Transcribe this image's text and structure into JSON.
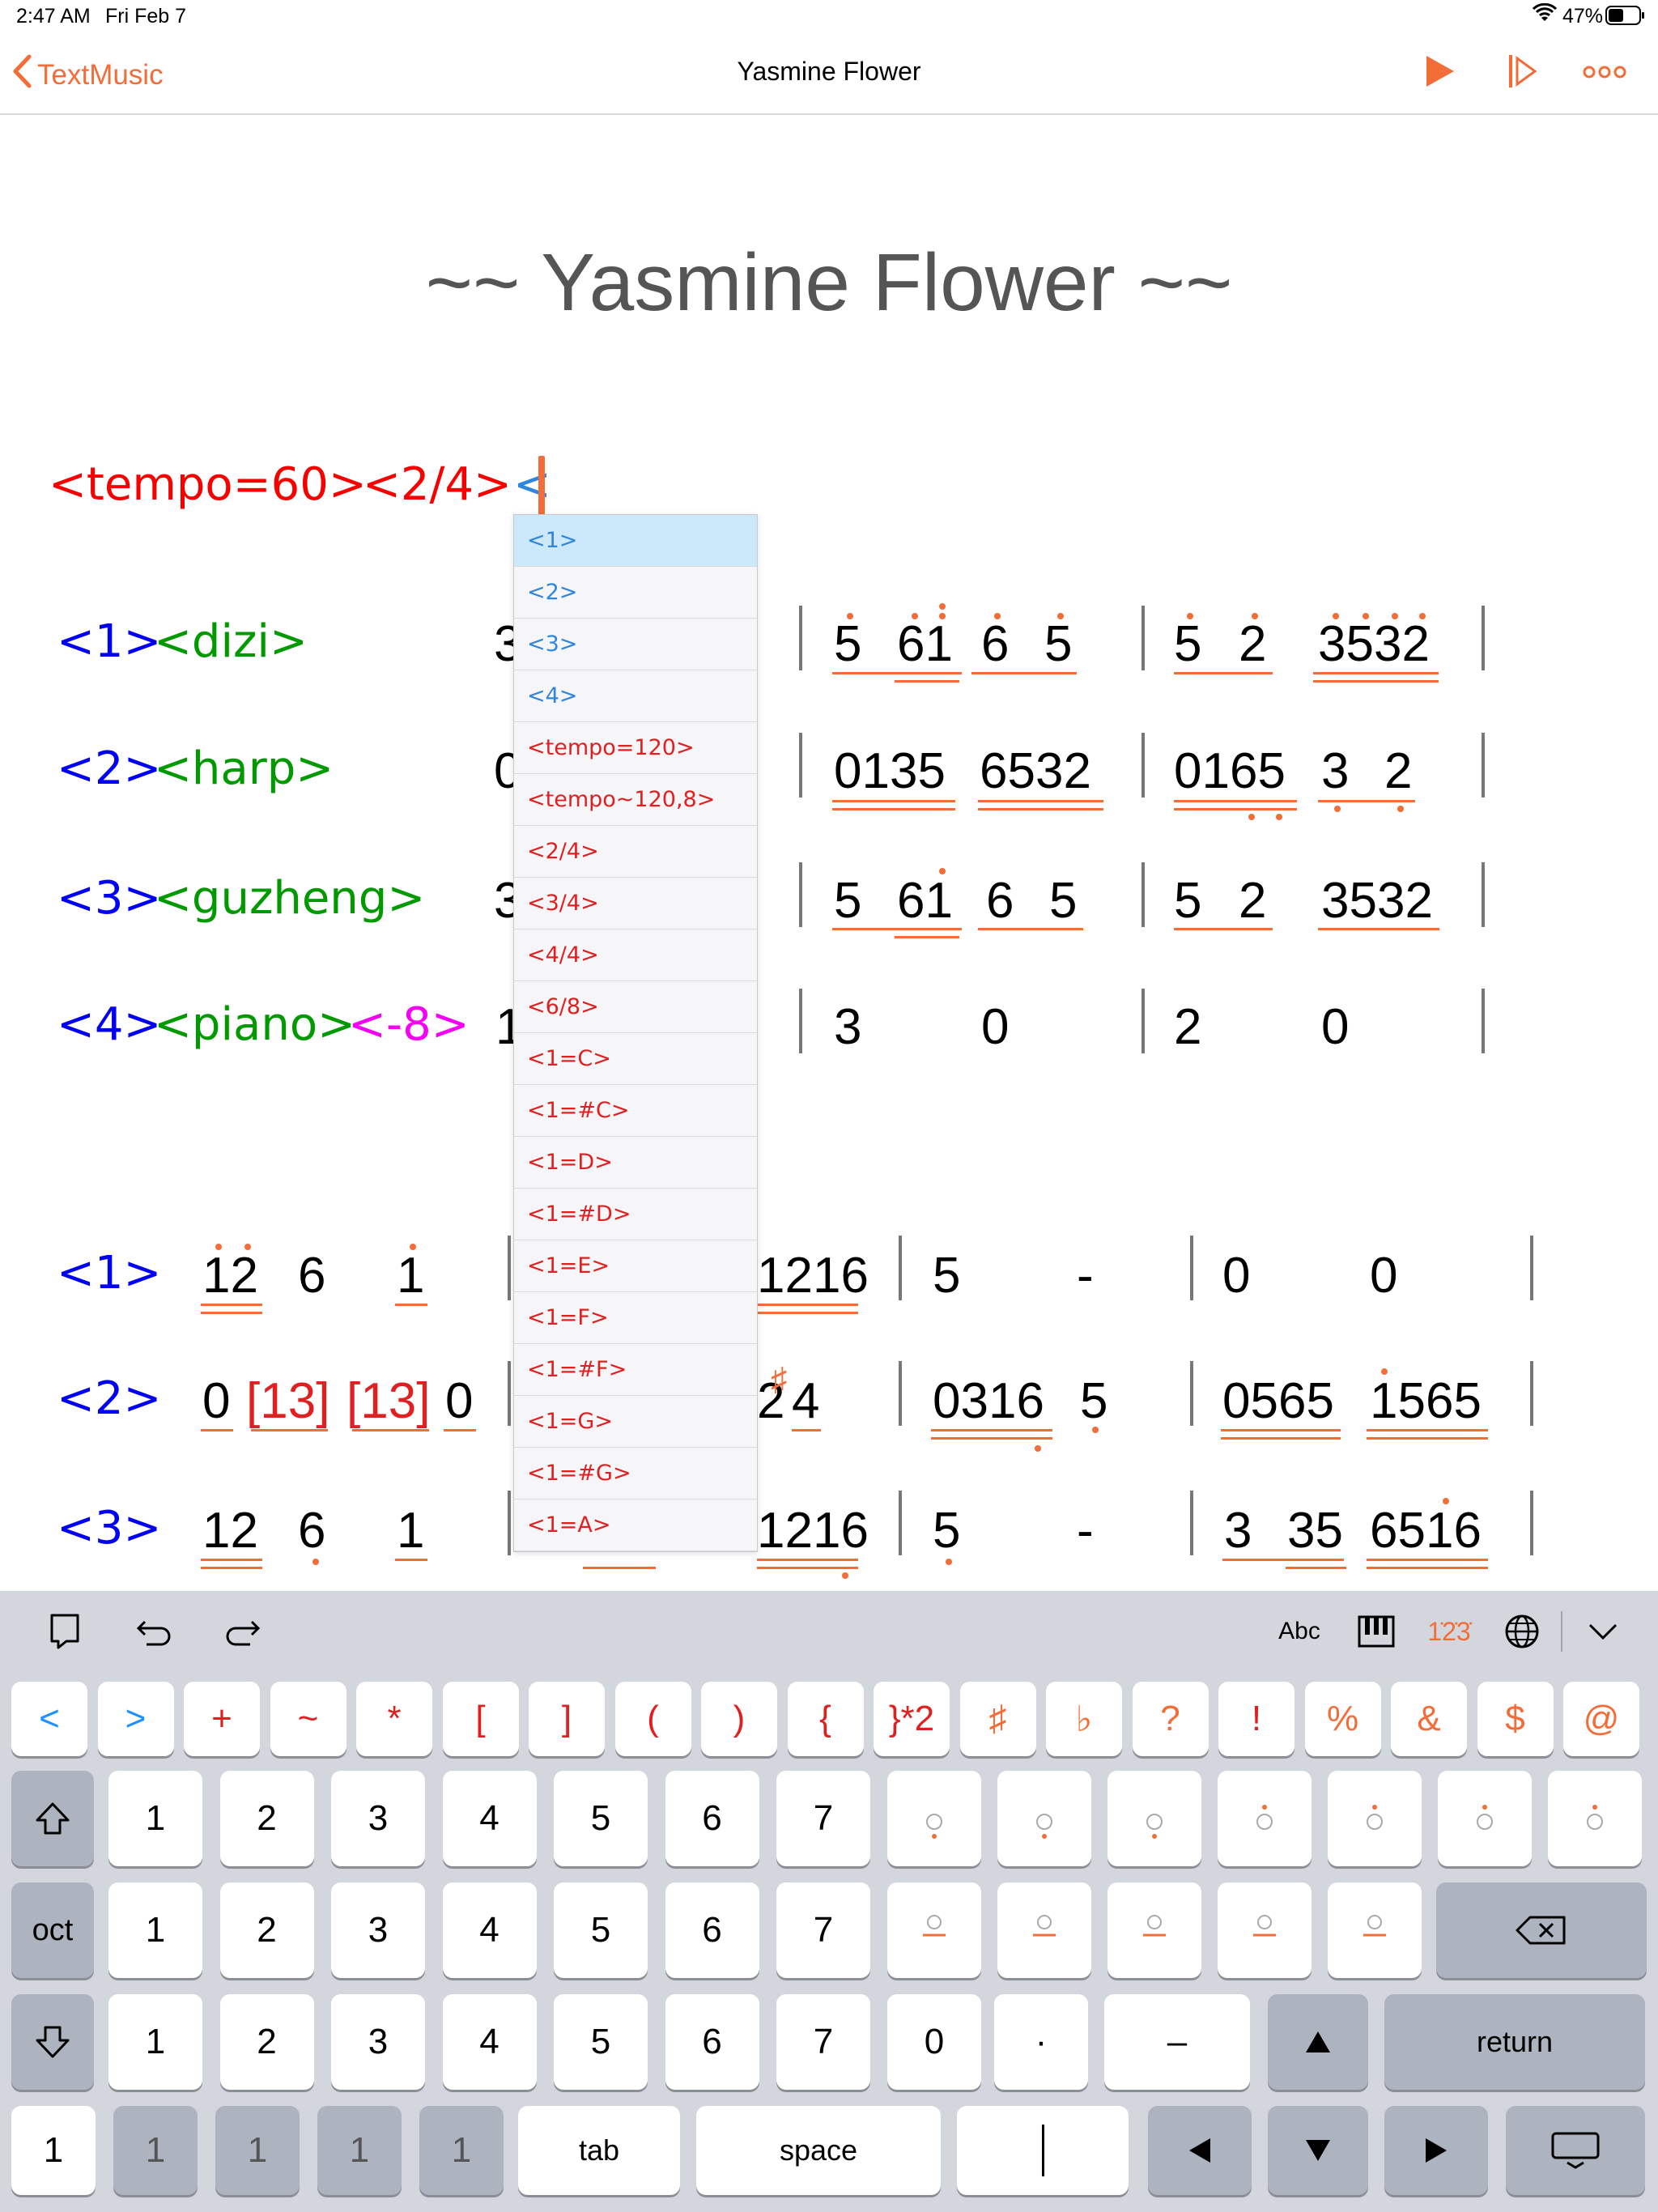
{
  "status_bar": {
    "time": "2:47 AM",
    "date": "Fri Feb 7",
    "battery": "47%"
  },
  "nav": {
    "back_label": "TextMusic",
    "title": "Yasmine Flower",
    "icons": [
      "play-icon",
      "play-step-icon",
      "more-icon"
    ]
  },
  "doc": {
    "title": "~~ Yasmine Flower ~~",
    "header_line": {
      "tempo": "<tempo=60>",
      "time_sig": "<2/4>",
      "typed": "<"
    },
    "system1": {
      "rows": [
        {
          "id": "<1>",
          "instrument": "<dizi>",
          "extra": "",
          "lead": "3",
          "m2": [
            "5",
            "61",
            "6",
            "5"
          ],
          "m3": [
            "5",
            "2",
            "3532"
          ]
        },
        {
          "id": "<2>",
          "instrument": "<harp>",
          "extra": "",
          "lead": "0",
          "m2": [
            "0135",
            "6532"
          ],
          "m3": [
            "0165",
            "3",
            "2"
          ]
        },
        {
          "id": "<3>",
          "instrument": "<guzheng>",
          "extra": "",
          "lead": "3",
          "m2": [
            "5",
            "61",
            "6",
            "5"
          ],
          "m3": [
            "5",
            "2",
            "3532"
          ]
        },
        {
          "id": "<4>",
          "instrument": "<piano>",
          "extra": "<-8>",
          "lead": "1",
          "m2": [
            "3",
            "0"
          ],
          "m3": [
            "2",
            "0"
          ]
        }
      ]
    },
    "system2": {
      "rows": [
        {
          "id": "<1>",
          "m1": [
            "12",
            "6",
            "1"
          ],
          "m2_tail": "1216",
          "m3": [
            "5",
            "-"
          ],
          "m4": [
            "0",
            "0"
          ]
        },
        {
          "id": "<2>",
          "m1": [
            "0",
            "[13]",
            "[13]",
            "0"
          ],
          "m2_tail": "2",
          "m2_sharp": "♯",
          "m2_last": "4",
          "m3": [
            "0316",
            "5"
          ],
          "m4": [
            "0565",
            "1565"
          ]
        },
        {
          "id": "<3>",
          "m1": [
            "12",
            "6",
            "1"
          ],
          "m2_tail": "1216",
          "m3": [
            "5",
            "-"
          ],
          "m4": [
            "3",
            "35",
            "6516"
          ]
        }
      ]
    }
  },
  "autocomplete": {
    "items": [
      {
        "label": "<1>",
        "kind": "blue"
      },
      {
        "label": "<2>",
        "kind": "blue"
      },
      {
        "label": "<3>",
        "kind": "blue"
      },
      {
        "label": "<4>",
        "kind": "blue"
      },
      {
        "label": "<tempo=120>",
        "kind": "red"
      },
      {
        "label": "<tempo~120,8>",
        "kind": "red"
      },
      {
        "label": "<2/4>",
        "kind": "red"
      },
      {
        "label": "<3/4>",
        "kind": "red"
      },
      {
        "label": "<4/4>",
        "kind": "red"
      },
      {
        "label": "<6/8>",
        "kind": "red"
      },
      {
        "label": "<1=C>",
        "kind": "red"
      },
      {
        "label": "<1=#C>",
        "kind": "red"
      },
      {
        "label": "<1=D>",
        "kind": "red"
      },
      {
        "label": "<1=#D>",
        "kind": "red"
      },
      {
        "label": "<1=E>",
        "kind": "red"
      },
      {
        "label": "<1=F>",
        "kind": "red"
      },
      {
        "label": "<1=#F>",
        "kind": "red"
      },
      {
        "label": "<1=G>",
        "kind": "red"
      },
      {
        "label": "<1=#G>",
        "kind": "red"
      },
      {
        "label": "<1=A>",
        "kind": "red"
      }
    ]
  },
  "keyboard": {
    "toolbar": {
      "abc": "Abc",
      "numpad_label": "1̇2̇3̇"
    },
    "row_symbols": [
      "<",
      ">",
      "+",
      "~",
      "*",
      "[",
      "]",
      "(",
      ")",
      "{",
      "}*2",
      "♯",
      "♭",
      "?",
      "!",
      "%",
      "&",
      "$",
      "@"
    ],
    "row_digits": [
      "1",
      "2",
      "3",
      "4",
      "5",
      "6",
      "7"
    ],
    "oct_label": "oct",
    "row3_extra": [
      "0",
      "·",
      "–"
    ],
    "return_label": "return",
    "tab_label": "tab",
    "space_label": "space",
    "first_key": "1",
    "underline_keys": [
      "1",
      "1",
      "1",
      "1"
    ]
  },
  "colors": {
    "accent": "#f26d38",
    "red": "#f70000",
    "blue": "#0000f5",
    "green": "#009a00",
    "magenta": "#f500f5"
  }
}
